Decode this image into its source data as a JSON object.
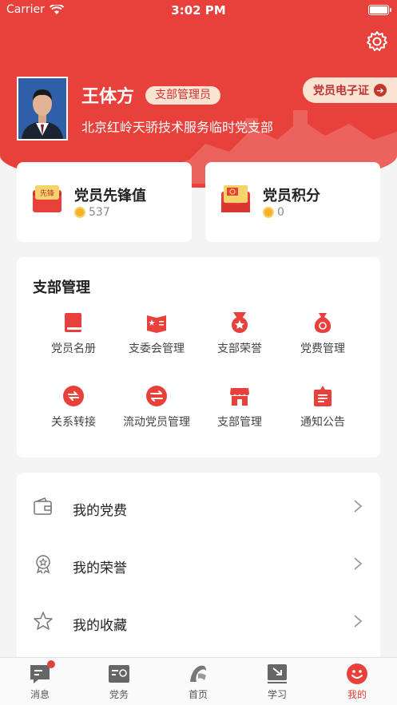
{
  "status_bar": {
    "carrier": "Carrier",
    "time": "3:02 PM"
  },
  "user": {
    "name": "王体方",
    "role": "支部管理员",
    "organization": "北京红岭天骄技术服务临时党支部",
    "id_card_label": "党员电子证"
  },
  "stats": [
    {
      "title": "党员先锋值",
      "value": "537",
      "icon": "vanguard-envelope-icon",
      "icon_text": "先锋"
    },
    {
      "title": "党员积分",
      "value": "0",
      "icon": "points-envelope-icon"
    }
  ],
  "branch": {
    "title": "支部管理",
    "items": [
      {
        "label": "党员名册",
        "icon": "book-icon"
      },
      {
        "label": "支委会管理",
        "icon": "committee-flag-icon"
      },
      {
        "label": "支部荣誉",
        "icon": "medal-icon"
      },
      {
        "label": "党费管理",
        "icon": "money-bag-icon"
      },
      {
        "label": "关系转接",
        "icon": "transfer-icon"
      },
      {
        "label": "流动党员管理",
        "icon": "flow-icon"
      },
      {
        "label": "支部管理",
        "icon": "storefront-icon"
      },
      {
        "label": "通知公告",
        "icon": "notice-icon"
      }
    ]
  },
  "menu": [
    {
      "label": "我的党费",
      "icon": "wallet-icon"
    },
    {
      "label": "我的荣誉",
      "icon": "award-icon"
    },
    {
      "label": "我的收藏",
      "icon": "star-icon"
    }
  ],
  "tabs": [
    {
      "label": "消息",
      "icon": "message-icon",
      "badge": true
    },
    {
      "label": "党务",
      "icon": "party-affairs-icon"
    },
    {
      "label": "首页",
      "icon": "home-logo-icon"
    },
    {
      "label": "学习",
      "icon": "study-icon"
    },
    {
      "label": "我的",
      "icon": "me-smile-icon",
      "active": true
    }
  ],
  "colors": {
    "primary": "#e8413b",
    "badge_bg": "#fbe3d2",
    "coin": "#f5b324"
  }
}
